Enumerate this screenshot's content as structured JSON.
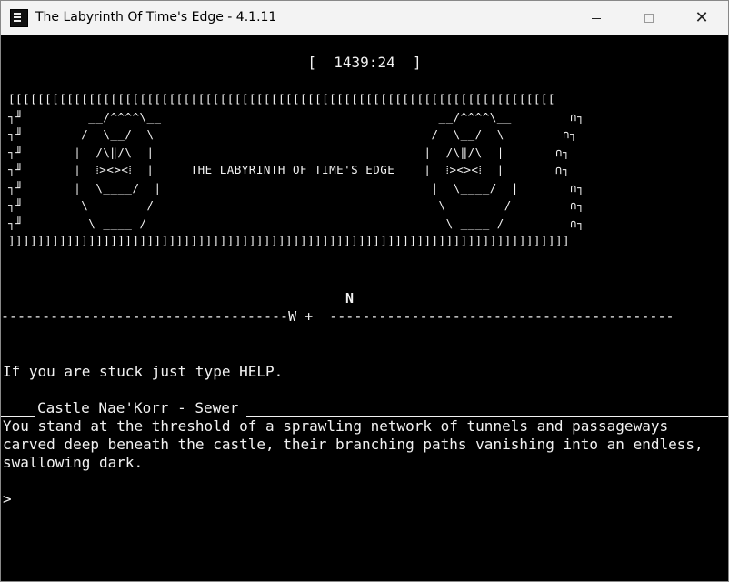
{
  "window": {
    "title": "The Labyrinth Of Time's Edge - 4.1.11",
    "minimize_icon": "minimize-icon",
    "maximize_icon": "maximize-icon",
    "close_label": "✕"
  },
  "terminal": {
    "timer": "[  1439:24  ]",
    "banner_lines": [
      " [[[[[[[[[[[[[[[[[[[[[[[[[[[[[[[[[[[[[[[[[[[[[[[[[[[[[[[[[[[[[[[[[[[[[[[[[[[",
      " ┐╜         __/^^^^\\__                                      __/^^^^\\__        ∩┐",
      " ┐╜        /  \\__/  \\                                      /  \\__/  \\        ∩┐",
      " ┐╜       |  /\\‖/\\  |                                     |  /\\‖/\\  |       ∩┐",
      " ┐╜       |  ⁞><><⁞  |     THE LABYRINTH OF TIME'S EDGE    |  ⁞><><⁞  |       ∩┐",
      " ┐╜       |  \\____/  |                                     |  \\____/  |       ∩┐",
      " ┐╜        \\        /                                       \\        /        ∩┐",
      " ┐╜         \\ ____ /                                         \\ ____ /         ∩┐",
      " ]]]]]]]]]]]]]]]]]]]]]]]]]]]]]]]]]]]]]]]]]]]]]]]]]]]]]]]]]]]]]]]]]]]]]]]]]]]]]"
    ],
    "compass_north": "N",
    "compass_line": "-----------------------------------W +  ------------------------------------------",
    "help_text": "If you are stuck just type HELP.",
    "room_title": "Castle Nae'Korr - Sewer",
    "description": "You stand at the threshold of a sprawling network of tunnels and passageways\ncarved deep beneath the castle, their branching paths vanishing into an endless,\nswallowing dark.",
    "prompt": ">",
    "input_value": ""
  }
}
